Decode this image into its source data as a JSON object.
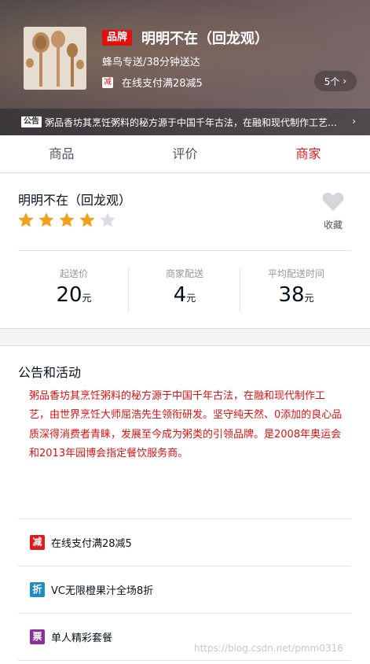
{
  "header": {
    "brand_badge": "品牌",
    "seller_name": "明明不在（回龙观）",
    "delivery": "蜂鸟专送/38分钟送达",
    "support": {
      "icon_text": "减",
      "text": "在线支付满28减5"
    },
    "support_count": "5个",
    "bulletin_tag": "公告",
    "bulletin_text": "粥品香坊其烹饪粥料的秘方源于中国千年古法，在融和现代制作工艺，由世界烹饪大师屈浩先生领衔研发。坚守纯天然、0添加的良心品质深得消费者青睐，发展至今成为粥类的引领品牌。是2008年奥运会和2013年园博会指定餐饮服务商。"
  },
  "tabs": [
    {
      "label": "商品",
      "active": false
    },
    {
      "label": "评价",
      "active": false
    },
    {
      "label": "商家",
      "active": true
    }
  ],
  "overview": {
    "name": "明明不在（回龙观）",
    "rating": 4,
    "rating_max": 5,
    "favorite_label": "收藏",
    "stats": [
      {
        "title": "起送价",
        "value": "20",
        "unit": "元"
      },
      {
        "title": "商家配送",
        "value": "4",
        "unit": "元"
      },
      {
        "title": "平均配送时间",
        "value": "38",
        "unit": "元"
      }
    ]
  },
  "bulletin": {
    "title": "公告和活动",
    "content": "粥品香坊其烹饪粥料的秘方源于中国千年古法，在融和现代制作工艺，由世界烹饪大师屈浩先生领衔研发。坚守纯天然、0添加的良心品质深得消费者青睐，发展至今成为粥类的引领品牌。是2008年奥运会和2013年园博会指定餐饮服务商。",
    "activities": [
      {
        "icon_text": "减",
        "icon_color": "#e01a1a",
        "text": "在线支付满28减5"
      },
      {
        "icon_text": "折",
        "icon_color": "#1d8bc8",
        "text": "VC无限橙果汁全场8折"
      },
      {
        "icon_text": "票",
        "icon_color": "#8a2f9b",
        "text": "单人精彩套餐"
      }
    ]
  },
  "colors": {
    "accent": "#e01a1a",
    "star": "#f1a21d",
    "star_off": "#d9dde1"
  },
  "watermark": "https://blog.csdn.net/pmm0316"
}
